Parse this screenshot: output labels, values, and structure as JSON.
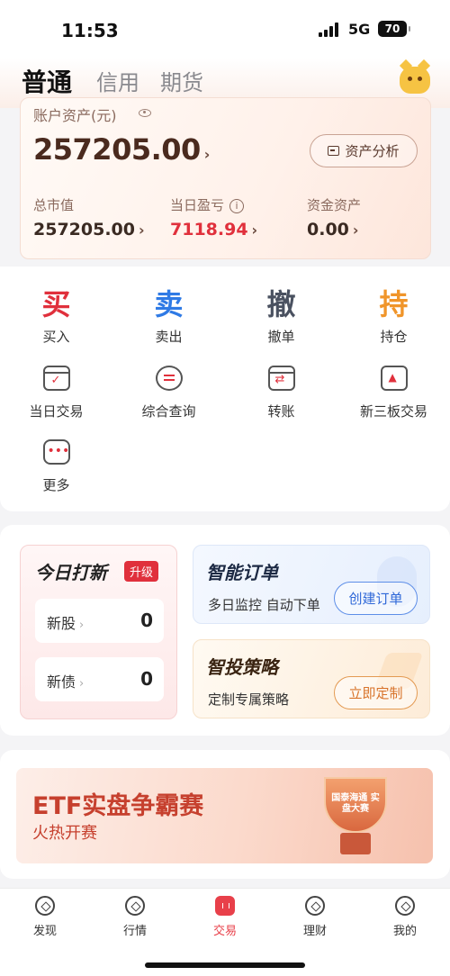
{
  "status_bar": {
    "time": "11:53",
    "network": "5G",
    "battery": "70"
  },
  "header": {
    "tabs": [
      {
        "label": "普通",
        "active": true
      },
      {
        "label": "信用",
        "active": false
      },
      {
        "label": "期货",
        "active": false
      }
    ],
    "mascot_icon": "mascot-cat-icon"
  },
  "asset": {
    "label": "账户资产(元)",
    "total": "257205.00",
    "analysis_button": "资产分析",
    "stats": [
      {
        "label": "总市值",
        "value": "257205.00"
      },
      {
        "label": "当日盈亏",
        "value": "7118.94"
      },
      {
        "label": "资金资产",
        "value": "0.00"
      }
    ]
  },
  "functions": {
    "primary": [
      {
        "glyph": "买",
        "label": "买入",
        "color": "#e0303c"
      },
      {
        "glyph": "卖",
        "label": "卖出",
        "color": "#2f7ae5"
      },
      {
        "glyph": "撤",
        "label": "撤单",
        "color": "#4a5160"
      },
      {
        "glyph": "持",
        "label": "持仓",
        "color": "#f0952a"
      }
    ],
    "secondary": [
      {
        "icon": "calendar-check-icon",
        "label": "当日交易"
      },
      {
        "icon": "query-icon",
        "label": "综合查询"
      },
      {
        "icon": "transfer-icon",
        "label": "转账"
      },
      {
        "icon": "board-chart-icon",
        "label": "新三板交易"
      },
      {
        "icon": "more-icon",
        "label": "更多"
      }
    ]
  },
  "ipo": {
    "title": "今日打新",
    "badge": "升级",
    "rows": [
      {
        "label": "新股",
        "count": "0"
      },
      {
        "label": "新债",
        "count": "0"
      }
    ]
  },
  "smart_order": {
    "title": "智能订单",
    "subtitle": "多日监控 自动下单",
    "button": "创建订单"
  },
  "smart_strategy": {
    "title": "智投策略",
    "subtitle": "定制专属策略",
    "button": "立即定制"
  },
  "banner": {
    "title": "ETF实盘争霸赛",
    "subtitle": "火热开赛",
    "trophy_text": "国泰海通 实盘大赛"
  },
  "bottom_nav": [
    {
      "label": "发现",
      "icon": "discover-icon",
      "active": false
    },
    {
      "label": "行情",
      "icon": "market-icon",
      "active": false
    },
    {
      "label": "交易",
      "icon": "trade-icon",
      "active": true
    },
    {
      "label": "理财",
      "icon": "wealth-icon",
      "active": false
    },
    {
      "label": "我的",
      "icon": "profile-icon",
      "active": false
    }
  ],
  "colors": {
    "accent_red": "#e0303c",
    "accent_blue": "#2f68d8",
    "accent_orange": "#d8732a"
  }
}
